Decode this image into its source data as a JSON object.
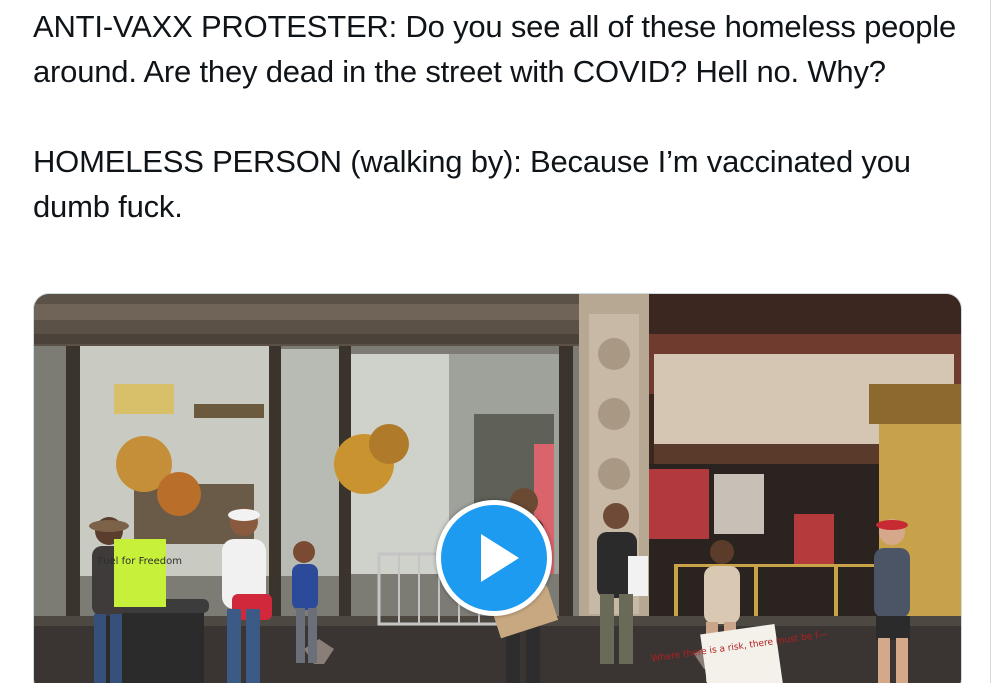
{
  "tweet": {
    "text_paragraphs": [
      "ANTI-VAXX PROTESTER: Do you see all of these homeless people around. Are they dead in the street with COVID? Hell no. Why?",
      "HOMELESS PERSON (walking by): Because I’m vaccinated you dumb fuck."
    ]
  },
  "media": {
    "type": "video",
    "play_icon": "play-icon",
    "sign_left_text": "Fuel for Freedom",
    "sign_right_text": "Where there is a risk, there must be f—",
    "colors": {
      "play_button": "#1d9bf0",
      "border": "#cfd9de",
      "text": "#0f1419"
    }
  }
}
